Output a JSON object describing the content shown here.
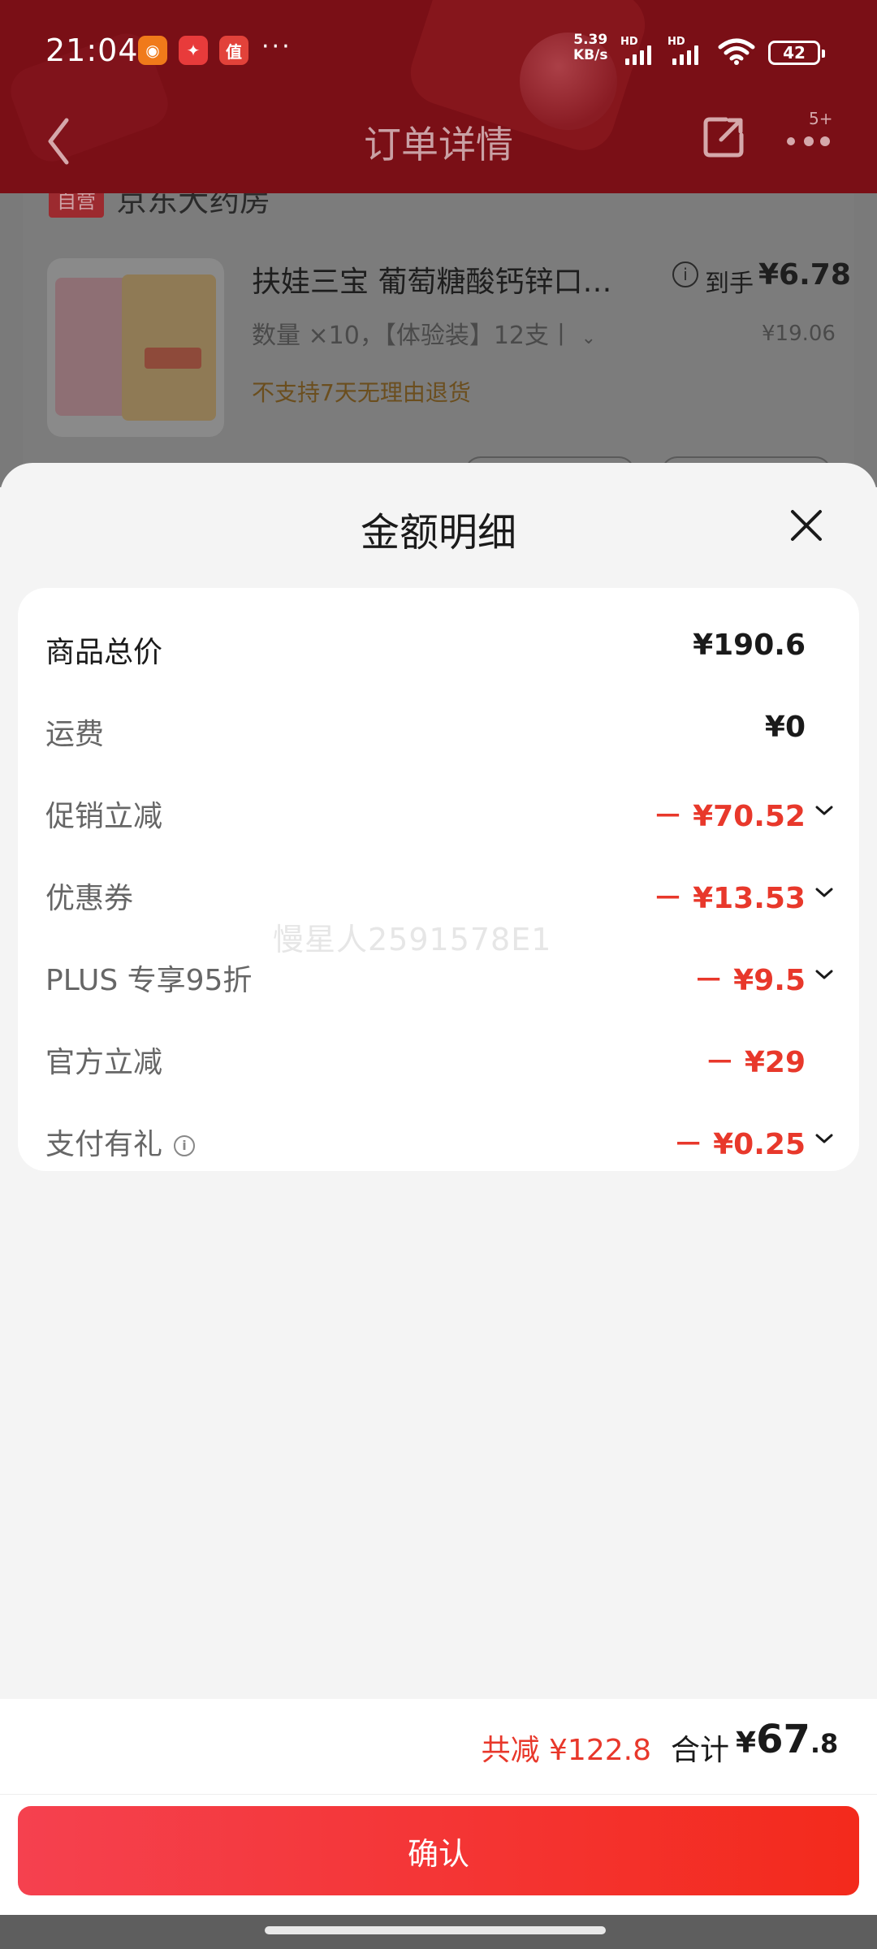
{
  "status_bar": {
    "time": "21:04",
    "app_icons": [
      "taobao-icon",
      "waimai-icon",
      "zhi-icon"
    ],
    "more": "···",
    "net_speed_value": "5.39",
    "net_speed_unit": "KB/s",
    "signal_label": "HD",
    "battery": "42"
  },
  "nav": {
    "title": "订单详情",
    "more_badge": "5+"
  },
  "order": {
    "store_tag": "自营",
    "store_name": "京东大药房",
    "product_name": "扶娃三宝 葡萄糖酸钙锌口…",
    "price_label": "到手",
    "price": "¥6.78",
    "quantity_spec": "数量 ×10，【体验装】12支丨",
    "original_price": "¥19.06",
    "notice": "不支持7天无理由退货"
  },
  "sheet": {
    "title": "金额明细",
    "rows": [
      {
        "label": "商品总价",
        "amount": "¥190.6"
      },
      {
        "label": "运费",
        "amount": "¥0"
      },
      {
        "label": "促销立减",
        "amount": "－ ¥70.52"
      },
      {
        "label": "优惠券",
        "amount": "－ ¥13.53"
      },
      {
        "label": "PLUS 专享95折",
        "amount": "－ ¥9.5"
      },
      {
        "label": "官方立减",
        "amount": "－ ¥29"
      },
      {
        "label": "支付有礼",
        "amount": "－ ¥0.25"
      }
    ],
    "watermark": "慢星人2591578E1",
    "saving": "共减 ¥122.8",
    "total_label": "合计",
    "total_currency": "¥",
    "total_int": "67",
    "total_dec": ".8",
    "confirm": "确认"
  },
  "colors": {
    "accent_red": "#e8382b",
    "button_start": "#f5414f",
    "button_end": "#f32a1c",
    "header_bg": "#7a0f16"
  }
}
